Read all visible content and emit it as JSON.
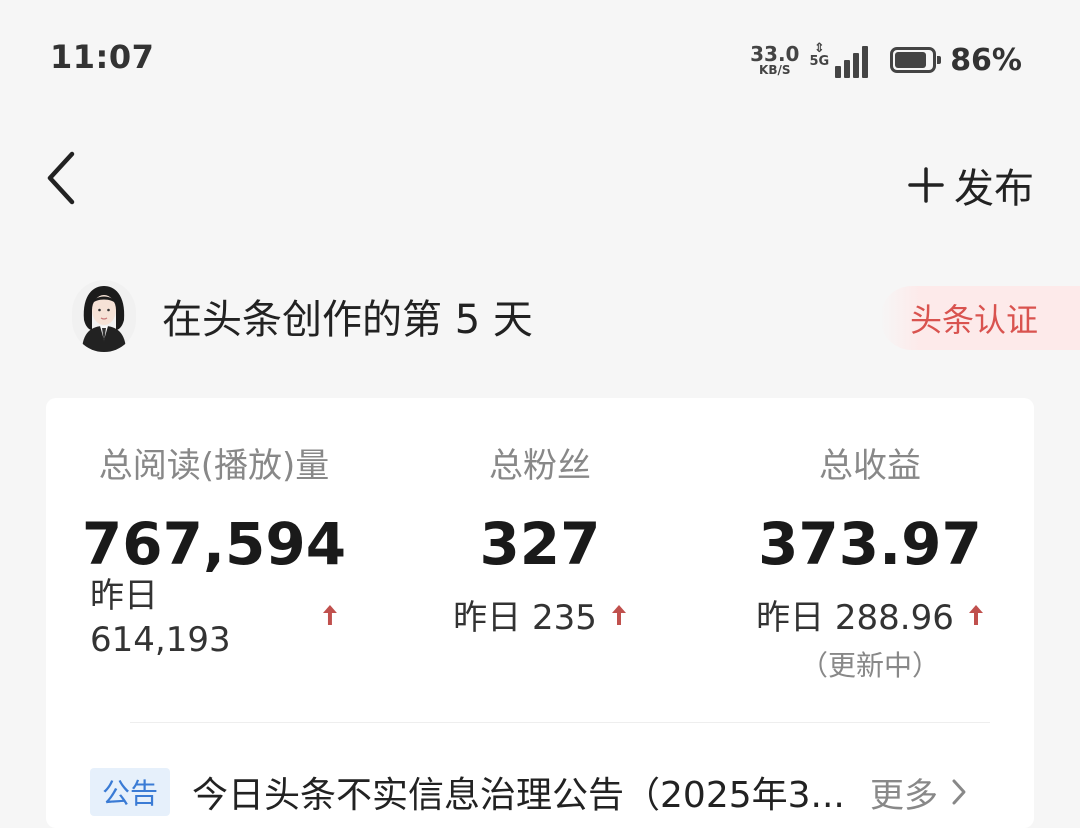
{
  "status_bar": {
    "time": "11:07",
    "net_speed": "33.0",
    "net_unit": "KB/S",
    "network_type": "5G",
    "battery_percent": "86%",
    "battery_level": 0.86
  },
  "nav": {
    "publish_label": "发布"
  },
  "profile": {
    "creation_text": "在头条创作的第 5 天",
    "cert_label": "头条认证"
  },
  "stats": {
    "reads": {
      "label": "总阅读(播放)量",
      "value": "767,594",
      "yesterday": "昨日 614,193"
    },
    "fans": {
      "label": "总粉丝",
      "value": "327",
      "yesterday": "昨日 235"
    },
    "income": {
      "label": "总收益",
      "value": "373.97",
      "yesterday": "昨日 288.96",
      "note": "（更新中）"
    }
  },
  "notice": {
    "tag": "公告",
    "text": "今日头条不实信息治理公告（2025年3...",
    "more_label": "更多"
  },
  "colors": {
    "up_arrow": "#c0504d",
    "cert_text": "#d9534f",
    "notice_tag_text": "#3a7bd5",
    "notice_tag_bg": "#e6f0fb"
  }
}
